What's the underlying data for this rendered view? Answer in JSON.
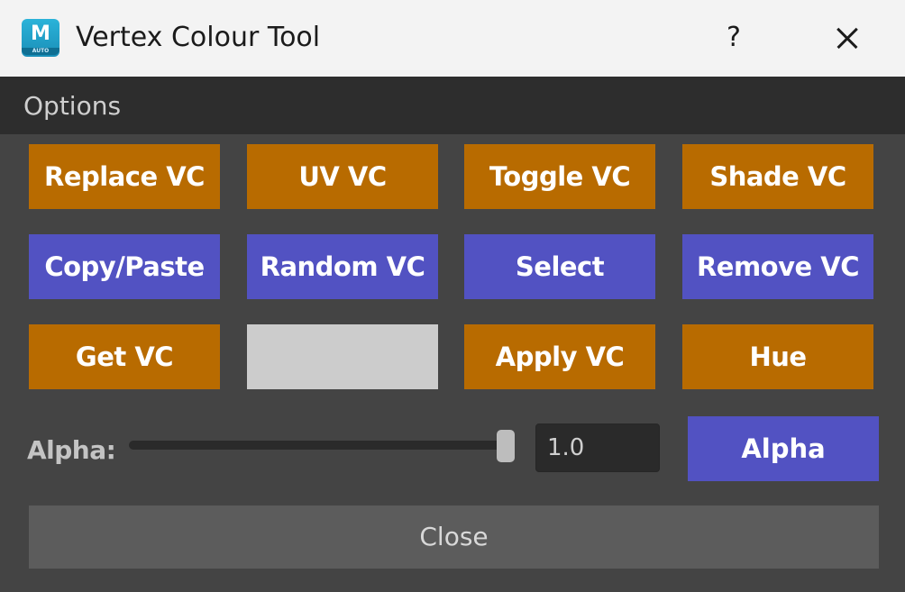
{
  "window": {
    "title": "Vertex Colour Tool",
    "app_icon_letter": "M",
    "app_icon_sub": "AUTO",
    "help_label": "?",
    "app_icon": "maya-app-icon",
    "close_icon": "close-icon"
  },
  "options": {
    "label": "Options"
  },
  "buttons": {
    "row1": [
      "Replace VC",
      "UV VC",
      "Toggle VC",
      "Shade VC"
    ],
    "row2": [
      "Copy/Paste",
      "Random VC",
      "Select",
      "Remove VC"
    ],
    "row3": [
      "Get VC",
      "",
      "Apply VC",
      "Hue"
    ]
  },
  "colour_swatch": {
    "color": "#cccccc"
  },
  "alpha": {
    "label": "Alpha:",
    "value": "1.0",
    "slider_fraction": 1.0,
    "button_label": "Alpha"
  },
  "footer": {
    "close_label": "Close"
  },
  "colors": {
    "orange_button": "#b86b00",
    "blue_button": "#5252c2",
    "panel_background": "#444444",
    "options_bar": "#2d2d2d",
    "close_button": "#5c5c5c"
  }
}
